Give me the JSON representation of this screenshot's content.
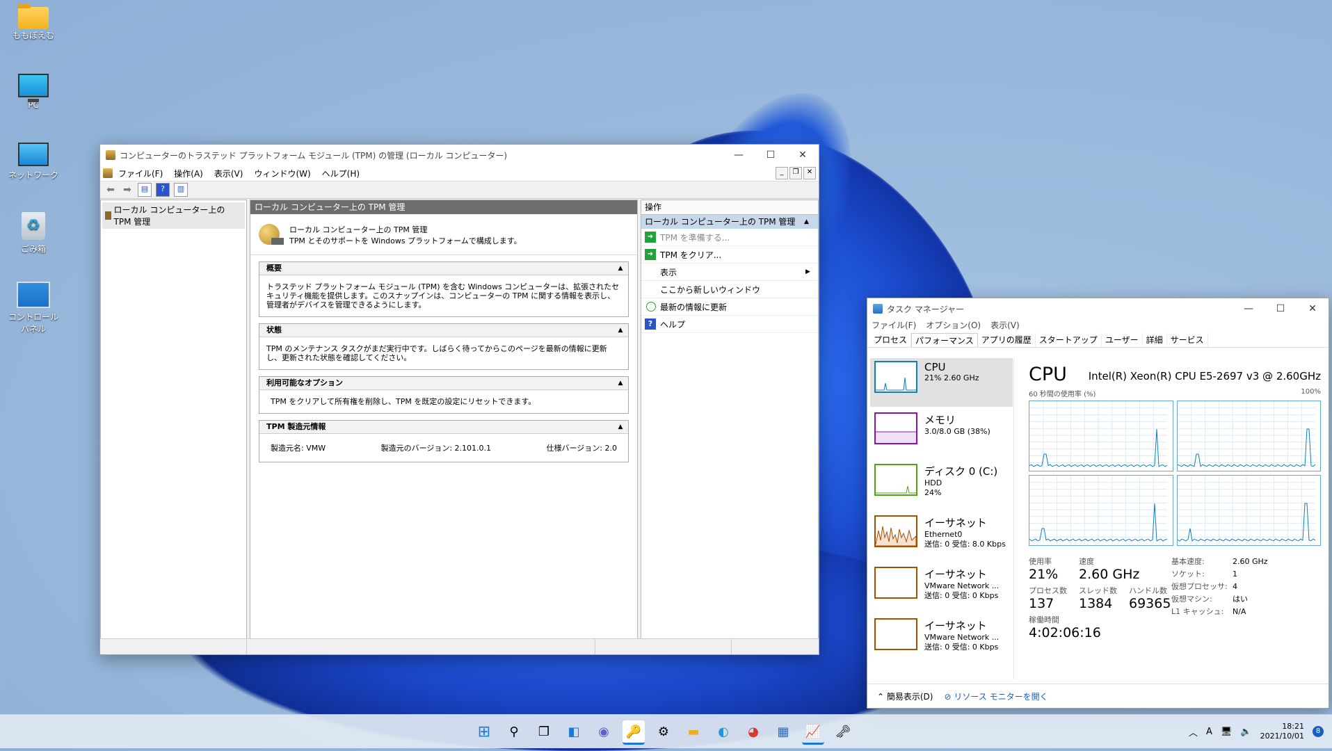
{
  "desktop": {
    "icons": [
      {
        "label": "ももぼえむ"
      },
      {
        "label": "PC"
      },
      {
        "label": "ネットワーク"
      },
      {
        "label": "ごみ箱"
      },
      {
        "label": "コントロール パネル"
      }
    ]
  },
  "mmc": {
    "title": "コンピューターのトラステッド プラットフォーム モジュール (TPM) の管理 (ローカル コンピューター)",
    "menu": [
      "ファイル(F)",
      "操作(A)",
      "表示(V)",
      "ウィンドウ(W)",
      "ヘルプ(H)"
    ],
    "tree_item": "ローカル コンピューター上の TPM 管理",
    "center_header": "ローカル コンピューター上の TPM 管理",
    "intro_line1": "ローカル コンピューター上の TPM 管理",
    "intro_line2": "TPM とそのサポートを Windows プラットフォームで構成します。",
    "sections": {
      "overview_title": "概要",
      "overview_body": "トラステッド プラットフォーム モジュール (TPM) を含む Windows コンピューターは、拡張されたセキュリティ機能を提供します。このスナップインは、コンピューターの TPM に関する情報を表示し、管理者がデバイスを管理できるようにします。",
      "status_title": "状態",
      "status_body": "TPM のメンテナンス タスクがまだ実行中です。しばらく待ってからこのページを最新の情報に更新し、更新された状態を確認してください。",
      "options_title": "利用可能なオプション",
      "options_body": "TPM をクリアして所有権を削除し、TPM を既定の設定にリセットできます。",
      "mfr_title": "TPM 製造元情報",
      "mfr_name": "製造元名:  VMW",
      "mfr_version": "製造元のバージョン:  2.101.0.1",
      "spec_version": "仕様バージョン:  2.0"
    },
    "actions": {
      "header": "操作",
      "sub": "ローカル コンピューター上の TPM 管理",
      "prepare": "TPM を準備する...",
      "clear": "TPM をクリア...",
      "view": "表示",
      "new_window": "ここから新しいウィンドウ",
      "refresh": "最新の情報に更新",
      "help": "ヘルプ"
    }
  },
  "taskmgr": {
    "title": "タスク マネージャー",
    "menu": [
      "ファイル(F)",
      "オプション(O)",
      "表示(V)"
    ],
    "tabs": [
      "プロセス",
      "パフォーマンス",
      "アプリの履歴",
      "スタートアップ",
      "ユーザー",
      "詳細",
      "サービス"
    ],
    "resources": [
      {
        "name": "CPU",
        "sub1": "21%  2.60 GHz",
        "sub2": "",
        "color": "#117dbb"
      },
      {
        "name": "メモリ",
        "sub1": "3.0/8.0 GB (38%)",
        "sub2": "",
        "color": "#8b12ae"
      },
      {
        "name": "ディスク 0 (C:)",
        "sub1": "HDD",
        "sub2": "24%",
        "color": "#4da60c"
      },
      {
        "name": "イーサネット",
        "sub1": "Ethernet0",
        "sub2": "送信: 0 受信: 8.0 Kbps",
        "color": "#a74f01"
      },
      {
        "name": "イーサネット",
        "sub1": "VMware Network ...",
        "sub2": "送信: 0 受信: 0 Kbps",
        "color": "#a74f01"
      },
      {
        "name": "イーサネット",
        "sub1": "VMware Network ...",
        "sub2": "送信: 0 受信: 0 Kbps",
        "color": "#a74f01"
      }
    ],
    "cpu_title": "CPU",
    "cpu_model": "Intel(R) Xeon(R) CPU E5-2697 v3 @ 2.60GHz",
    "graph_label": "60 秒間の使用率 (%)",
    "graph_max": "100%",
    "stats": {
      "usage_lbl": "使用率",
      "usage": "21%",
      "speed_lbl": "速度",
      "speed": "2.60 GHz",
      "proc_lbl": "プロセス数",
      "proc": "137",
      "thread_lbl": "スレッド数",
      "thread": "1384",
      "handle_lbl": "ハンドル数",
      "handle": "69365",
      "uptime_lbl": "稼働時間",
      "uptime": "4:02:06:16"
    },
    "specs": [
      {
        "k": "基本速度:",
        "v": "2.60 GHz"
      },
      {
        "k": "ソケット:",
        "v": "1"
      },
      {
        "k": "仮想プロセッサ:",
        "v": "4"
      },
      {
        "k": "仮想マシン:",
        "v": "はい"
      },
      {
        "k": "L1 キャッシュ:",
        "v": "N/A"
      }
    ],
    "footer_less": "簡易表示(D)",
    "footer_monitor": "リソース モニターを開く"
  },
  "taskbar": {
    "time": "18:21",
    "date": "2021/10/01",
    "notifications": "8",
    "ime": "A"
  }
}
